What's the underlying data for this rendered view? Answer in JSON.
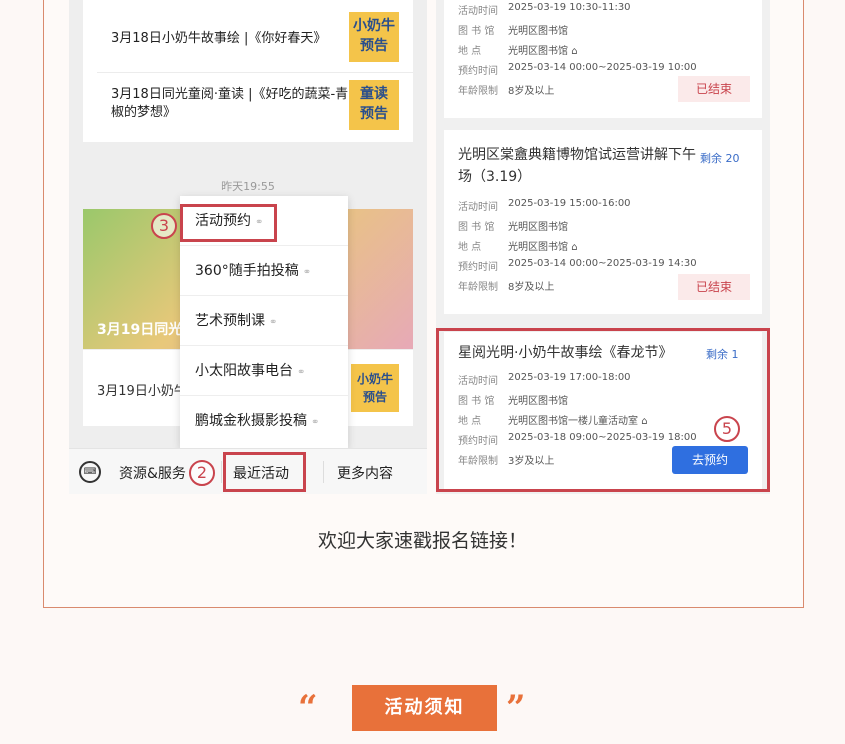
{
  "left_panel": {
    "messages": [
      {
        "title": "3月18日小奶牛故事绘 |《你好春天》",
        "thumb": "小奶牛\n预告"
      },
      {
        "title": "3月18日同光童阅·童读 |《好吃的蔬菜-青椒的梦想》",
        "thumb": "童读\n预告"
      }
    ],
    "timestamp": "昨天19:55",
    "banner_caption": "3月19日同光",
    "row2_title": "3月19日小奶牛",
    "row2_thumb": "小奶牛\n预告",
    "popup_items": [
      "活动预约",
      "360°随手拍投稿",
      "艺术预制课",
      "小太阳故事电台",
      "鹏城金秋摄影投稿"
    ],
    "bottom_bar": {
      "resources": "资源&服务",
      "recent": "最近活动",
      "more": "更多内容"
    },
    "markers": {
      "popup": "3",
      "bar": "2"
    }
  },
  "right_panel": {
    "labels": {
      "time": "活动时间",
      "library": "图 书 馆",
      "place": "地      点",
      "reserve_time": "预约时间",
      "age": "年龄限制"
    },
    "events": [
      {
        "time": "2025-03-19 10:30-11:30",
        "library": "光明区图书馆",
        "place": "光明区图书馆",
        "reserve_time": "2025-03-14 00:00~2025-03-19 10:00",
        "age": "8岁及以上",
        "status": "已结束"
      },
      {
        "title": "光明区棠盦典籍博物馆试运营讲解下午场（3.19）",
        "remain": "剩余 20",
        "time": "2025-03-19 15:00-16:00",
        "library": "光明区图书馆",
        "place": "光明区图书馆",
        "reserve_time": "2025-03-14 00:00~2025-03-19 14:30",
        "age": "8岁及以上",
        "status": "已结束"
      },
      {
        "title": "星阅光明·小奶牛故事绘《春龙节》",
        "remain": "剩余 1",
        "time": "2025-03-19 17:00-18:00",
        "library": "光明区图书馆",
        "place": "光明区图书馆一楼儿童活动室",
        "reserve_time": "2025-03-18 09:00~2025-03-19 18:00",
        "age": "3岁及以上",
        "action": "去预约"
      }
    ],
    "marker": "5"
  },
  "caption": "欢迎大家速戳报名链接！",
  "section_header": {
    "title": "活动须知",
    "quote_open": "“",
    "quote_close": "”"
  },
  "colors": {
    "accent": "#e8713a",
    "highlight_red": "#c9444d",
    "reserve_blue": "#2f6fe0"
  }
}
